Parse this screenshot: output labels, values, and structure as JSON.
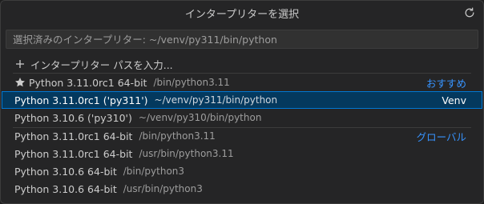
{
  "title": "インタープリターを選択",
  "input": {
    "placeholder": "選択済みのインタープリター: ~/venv/py311/bin/python",
    "value": ""
  },
  "add_item": {
    "label": "インタープリター パスを入力..."
  },
  "recommended": {
    "label": "Python 3.11.0rc1 64-bit",
    "path": "/bin/python3.11",
    "category": "おすすめ"
  },
  "venv_items": [
    {
      "label": "Python 3.11.0rc1 ('py311')",
      "path": "~/venv/py311/bin/python",
      "category": "Venv"
    },
    {
      "label": "Python 3.10.6 ('py310')",
      "path": "~/venv/py310/bin/python"
    }
  ],
  "global_items": [
    {
      "label": "Python 3.11.0rc1 64-bit",
      "path": "/bin/python3.11",
      "category": "グローバル"
    },
    {
      "label": "Python 3.11.0rc1 64-bit",
      "path": "/usr/bin/python3.11"
    },
    {
      "label": "Python 3.10.6 64-bit",
      "path": "/bin/python3"
    },
    {
      "label": "Python 3.10.6 64-bit",
      "path": "/usr/bin/python3"
    }
  ],
  "colors": {
    "accent": "#3794ff",
    "selected_bg": "#04395e",
    "focus_border": "#0078d4"
  },
  "icons": {
    "refresh": "refresh-icon",
    "add": "plus-icon",
    "star": "star-icon"
  }
}
